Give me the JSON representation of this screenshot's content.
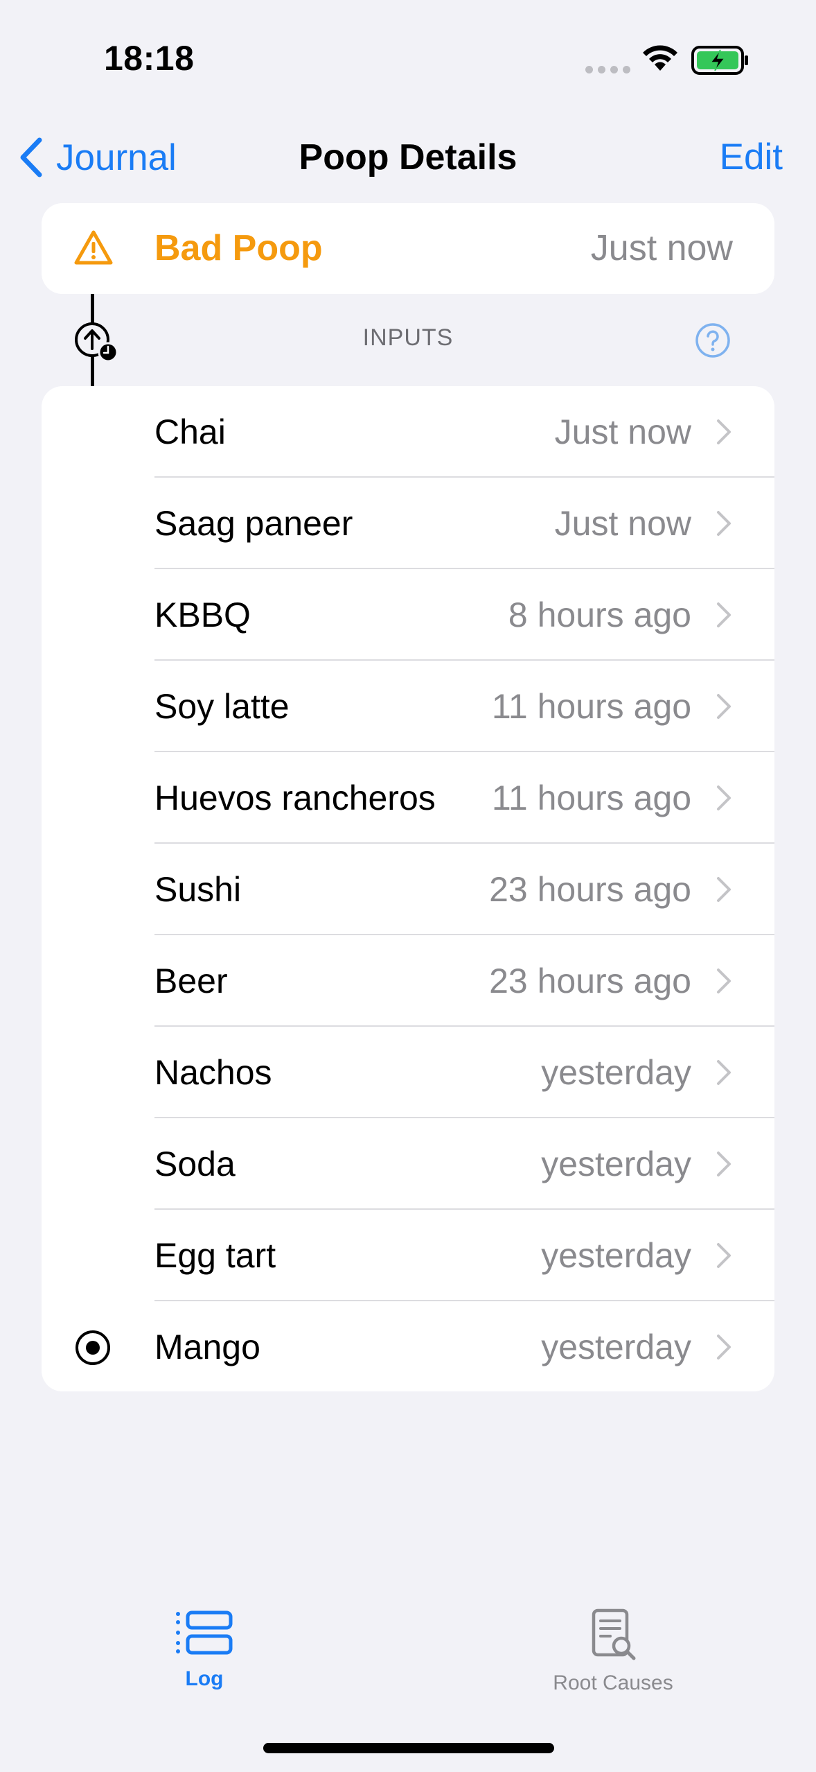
{
  "status_bar": {
    "time": "18:18"
  },
  "nav": {
    "back_label": "Journal",
    "title": "Poop Details",
    "edit_label": "Edit"
  },
  "event": {
    "title": "Bad Poop",
    "time": "Just now",
    "accent_color": "#f59a0e"
  },
  "inputs_section": {
    "header": "INPUTS"
  },
  "inputs": [
    {
      "label": "Chai",
      "time": "Just now"
    },
    {
      "label": "Saag paneer",
      "time": "Just now"
    },
    {
      "label": "KBBQ",
      "time": "8 hours ago"
    },
    {
      "label": "Soy latte",
      "time": "11 hours ago"
    },
    {
      "label": "Huevos rancheros",
      "time": "11 hours ago"
    },
    {
      "label": "Sushi",
      "time": "23 hours ago"
    },
    {
      "label": "Beer",
      "time": "23 hours ago"
    },
    {
      "label": "Nachos",
      "time": "yesterday"
    },
    {
      "label": "Soda",
      "time": "yesterday"
    },
    {
      "label": "Egg tart",
      "time": "yesterday"
    },
    {
      "label": "Mango",
      "time": "yesterday"
    }
  ],
  "tabs": [
    {
      "label": "Log",
      "icon": "list-icon",
      "selected": true
    },
    {
      "label": "Root Causes",
      "icon": "document-search-icon",
      "selected": false
    }
  ],
  "colors": {
    "accent": "#1a7cf5",
    "warning": "#f59a0e",
    "background": "#f2f2f7"
  }
}
